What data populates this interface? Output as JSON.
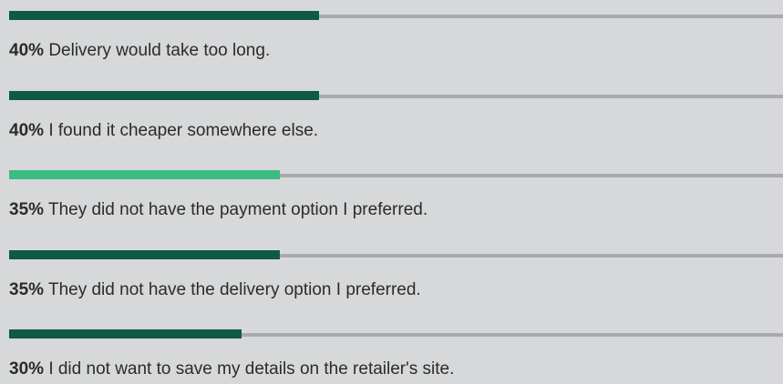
{
  "chart_data": {
    "type": "bar",
    "orientation": "horizontal",
    "xlim": [
      0,
      100
    ],
    "grid": false,
    "categories": [
      "Delivery would take too long.",
      "I found it cheaper somewhere else.",
      "They did not have the payment option I preferred.",
      "They did not have the delivery option I preferred.",
      "I did not want to save my details on the retailer's site."
    ],
    "values": [
      40,
      40,
      35,
      35,
      30
    ],
    "value_labels": [
      "40%",
      "40%",
      "35%",
      "35%",
      "30%"
    ],
    "colors": [
      "#0e5a43",
      "#0e5a43",
      "#3cbb82",
      "#0e5a43",
      "#0e5a43"
    ],
    "track_color": "#a9aaab"
  }
}
